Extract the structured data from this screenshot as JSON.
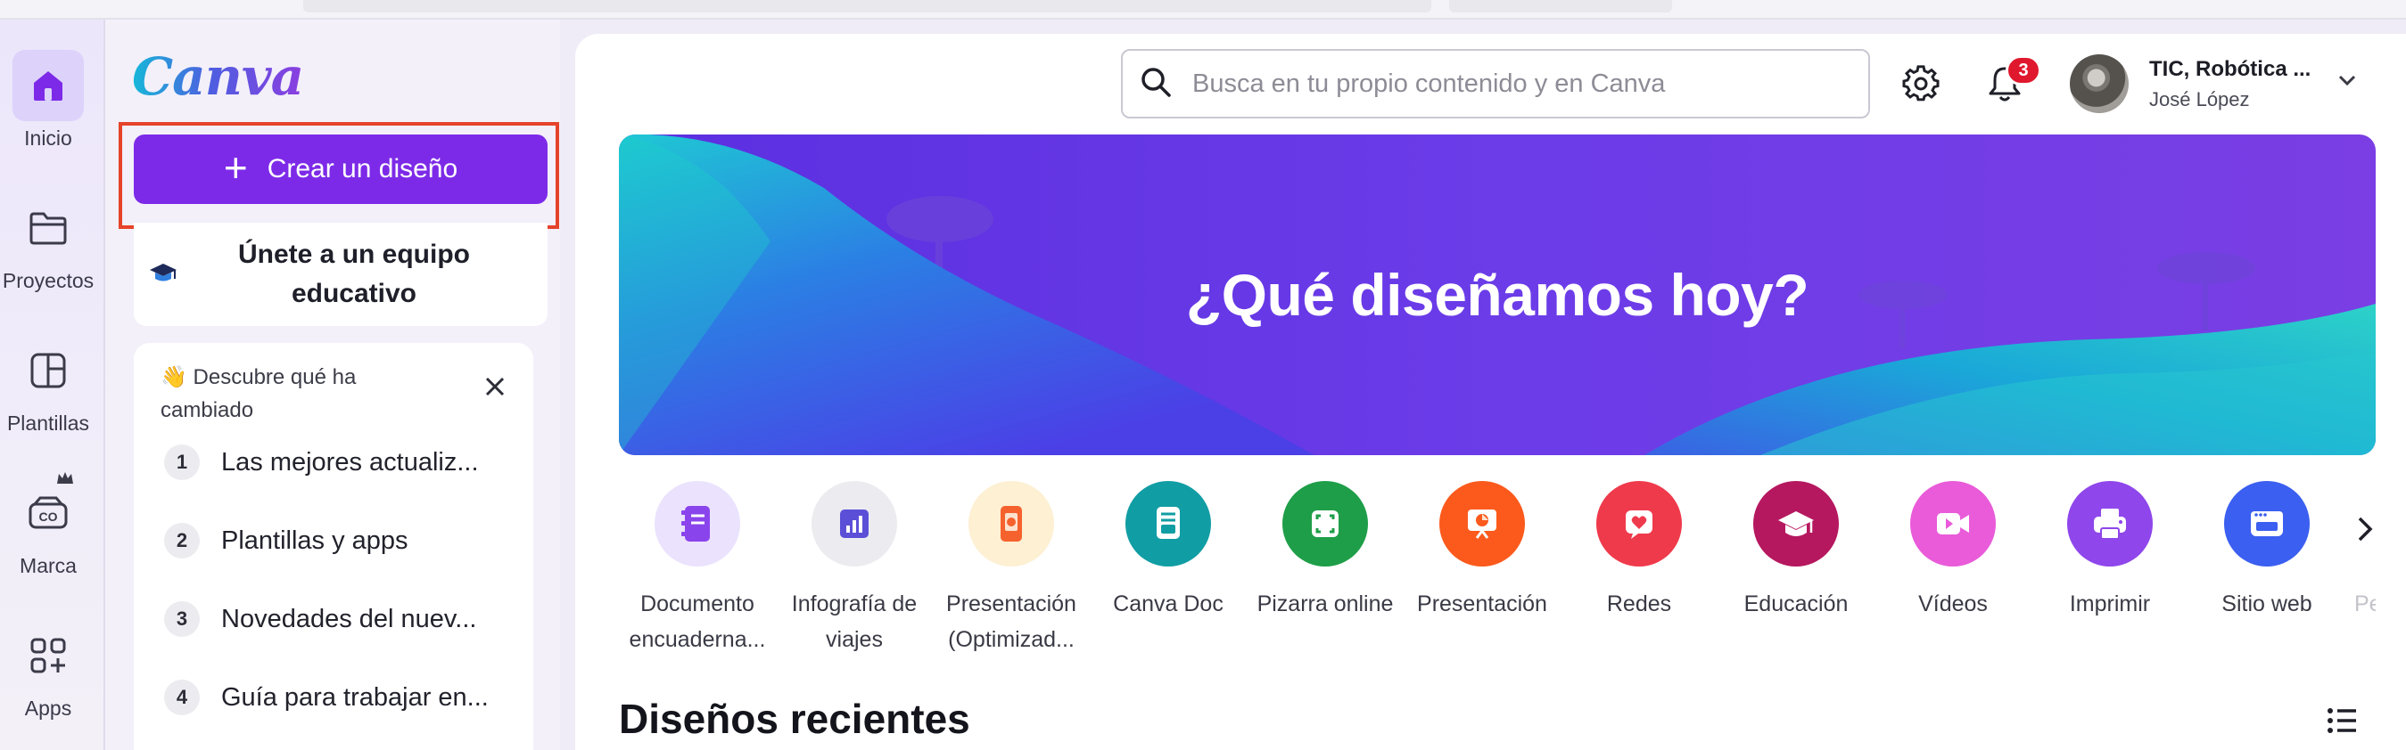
{
  "rail": {
    "items": [
      {
        "label": "Inicio",
        "icon": "home-icon"
      },
      {
        "label": "Proyectos",
        "icon": "folder-icon"
      },
      {
        "label": "Plantillas",
        "icon": "templates-icon"
      },
      {
        "label": "Marca",
        "icon": "brand-icon"
      },
      {
        "label": "Apps",
        "icon": "apps-icon"
      }
    ]
  },
  "sidebar": {
    "logo": "Canva",
    "create_label": "Crear un diseño",
    "team_card": "Únete a un equipo educativo",
    "discover": {
      "title": "👋 Descubre qué ha cambiado",
      "items": [
        {
          "num": "1",
          "label": "Las mejores actualiz..."
        },
        {
          "num": "2",
          "label": "Plantillas y apps"
        },
        {
          "num": "3",
          "label": "Novedades del nuev..."
        },
        {
          "num": "4",
          "label": "Guía para trabajar en..."
        }
      ]
    }
  },
  "header": {
    "search_placeholder": "Busca en tu propio contenido y en Canva",
    "notifications": "3",
    "account_name": "TIC, Robótica ...",
    "account_user": "José López"
  },
  "hero": {
    "title": "¿Qué diseñamos hoy?"
  },
  "categories": [
    {
      "label": "Documento encuaderna...",
      "color": "#ebe2fd",
      "icon": "bound-document-icon"
    },
    {
      "label": "Infografía de viajes",
      "color": "#ececf0",
      "icon": "infographic-icon"
    },
    {
      "label": "Presentación (Optimizad...",
      "color": "#fdf0d3",
      "icon": "presentation-mobile-icon"
    },
    {
      "label": "Canva Doc",
      "color": "#119da4",
      "icon": "canva-doc-icon"
    },
    {
      "label": "Pizarra online",
      "color": "#1e9e48",
      "icon": "whiteboard-icon"
    },
    {
      "label": "Presentación",
      "color": "#fb5a1c",
      "icon": "presentation-icon"
    },
    {
      "label": "Redes",
      "color": "#ef3a4c",
      "icon": "social-heart-icon"
    },
    {
      "label": "Educación",
      "color": "#b5185f",
      "icon": "education-cap-icon"
    },
    {
      "label": "Vídeos",
      "color": "#e95bd9",
      "icon": "video-icon"
    },
    {
      "label": "Imprimir",
      "color": "#8f46eb",
      "icon": "print-icon"
    },
    {
      "label": "Sitio web",
      "color": "#3b5ff0",
      "icon": "website-icon"
    },
    {
      "label": "Pe...",
      "color": "#ffffff",
      "icon": "more-icon"
    }
  ],
  "recent": {
    "title": "Diseños recientes"
  },
  "colors": {
    "accent": "#7d2ae8",
    "highlight": "#e5432a"
  }
}
